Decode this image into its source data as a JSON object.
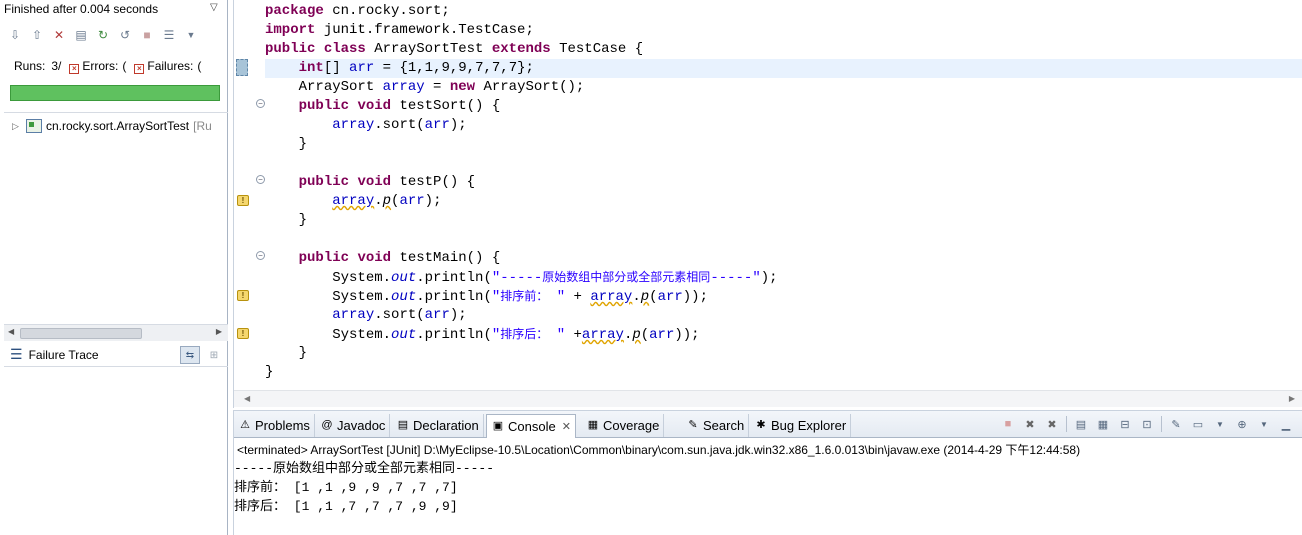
{
  "junit": {
    "status": "Finished after 0.004 seconds",
    "menu_glyph": "▽",
    "toolbar_icons": [
      "next-failure-icon",
      "prev-failure-icon",
      "show-failures-only-icon",
      "scroll-lock-icon",
      "rerun-icon",
      "rerun-failed-icon",
      "stop-icon",
      "history-icon",
      "dropdown-icon"
    ],
    "runs_label": "Runs:",
    "runs_value": "3/",
    "errors_label": "Errors:",
    "errors_value": "(",
    "failures_label": "Failures:",
    "failures_value": "(",
    "progress_fraction": 1.0,
    "tree_item_name": "cn.rocky.sort.ArraySortTest",
    "tree_item_suffix": "[Ru",
    "failure_trace_label": "Failure Trace"
  },
  "editor": {
    "lines": [
      {
        "indent": "",
        "parts": [
          [
            "kw",
            "package"
          ],
          [
            "p",
            " cn.rocky.sort;"
          ]
        ]
      },
      {
        "indent": "",
        "parts": [
          [
            "kw",
            "import"
          ],
          [
            "p",
            " junit.framework.TestCase;"
          ]
        ]
      },
      {
        "indent": "",
        "parts": [
          [
            "kw",
            "public"
          ],
          [
            "p",
            " "
          ],
          [
            "kw",
            "class"
          ],
          [
            "p",
            " ArraySortTest "
          ],
          [
            "kw",
            "extends"
          ],
          [
            "p",
            " TestCase {"
          ]
        ]
      },
      {
        "indent": "    ",
        "current": true,
        "parts": [
          [
            "kw",
            "int"
          ],
          [
            "p",
            "[] "
          ],
          [
            "fld",
            "arr"
          ],
          [
            "p",
            " = {1,1,9,9,7,7,7};"
          ]
        ]
      },
      {
        "indent": "    ",
        "parts": [
          [
            "p",
            "ArraySort "
          ],
          [
            "fld",
            "array"
          ],
          [
            "p",
            " = "
          ],
          [
            "kw",
            "new"
          ],
          [
            "p",
            " ArraySort();"
          ]
        ]
      },
      {
        "indent": "    ",
        "parts": [
          [
            "kw",
            "public"
          ],
          [
            "p",
            " "
          ],
          [
            "kw",
            "void"
          ],
          [
            "p",
            " testSort() {"
          ]
        ]
      },
      {
        "indent": "        ",
        "parts": [
          [
            "fld",
            "array"
          ],
          [
            "p",
            ".sort("
          ],
          [
            "fld",
            "arr"
          ],
          [
            "p",
            ");"
          ]
        ]
      },
      {
        "indent": "    ",
        "parts": [
          [
            "p",
            "}"
          ]
        ]
      },
      {
        "indent": "",
        "parts": []
      },
      {
        "indent": "    ",
        "parts": [
          [
            "kw",
            "public"
          ],
          [
            "p",
            " "
          ],
          [
            "kw",
            "void"
          ],
          [
            "p",
            " testP() {"
          ]
        ]
      },
      {
        "indent": "        ",
        "parts": [
          [
            "fld-w",
            "array"
          ],
          [
            "p",
            "."
          ],
          [
            "ital-w",
            "p"
          ],
          [
            "p",
            "("
          ],
          [
            "fld",
            "arr"
          ],
          [
            "p",
            ");"
          ]
        ]
      },
      {
        "indent": "    ",
        "parts": [
          [
            "p",
            "}"
          ]
        ]
      },
      {
        "indent": "",
        "parts": []
      },
      {
        "indent": "    ",
        "parts": [
          [
            "kw",
            "public"
          ],
          [
            "p",
            " "
          ],
          [
            "kw",
            "void"
          ],
          [
            "p",
            " testMain() {"
          ]
        ]
      },
      {
        "indent": "        ",
        "parts": [
          [
            "p",
            "System."
          ],
          [
            "fld-i",
            "out"
          ],
          [
            "p",
            ".println("
          ],
          [
            "str",
            "\"-----"
          ],
          [
            "str-cjk",
            "原始数组中部分或全部元素相同"
          ],
          [
            "str",
            "-----\""
          ],
          [
            "p",
            ");"
          ]
        ]
      },
      {
        "indent": "        ",
        "parts": [
          [
            "p",
            "System."
          ],
          [
            "fld-i",
            "out"
          ],
          [
            "p",
            ".println("
          ],
          [
            "str",
            "\""
          ],
          [
            "str-cjk",
            "排序前："
          ],
          [
            "str",
            " \""
          ],
          [
            "p",
            " + "
          ],
          [
            "fld-w",
            "array"
          ],
          [
            "p",
            "."
          ],
          [
            "ital-w",
            "p"
          ],
          [
            "p",
            "("
          ],
          [
            "fld",
            "arr"
          ],
          [
            "p",
            "));"
          ]
        ]
      },
      {
        "indent": "        ",
        "parts": [
          [
            "fld",
            "array"
          ],
          [
            "p",
            ".sort("
          ],
          [
            "fld",
            "arr"
          ],
          [
            "p",
            ");"
          ]
        ]
      },
      {
        "indent": "        ",
        "parts": [
          [
            "p",
            "System."
          ],
          [
            "fld-i",
            "out"
          ],
          [
            "p",
            ".println("
          ],
          [
            "str",
            "\""
          ],
          [
            "str-cjk",
            "排序后："
          ],
          [
            "str",
            " \""
          ],
          [
            "p",
            " +"
          ],
          [
            "fld-w",
            "array"
          ],
          [
            "p",
            "."
          ],
          [
            "ital-w",
            "p"
          ],
          [
            "p",
            "("
          ],
          [
            "fld",
            "arr"
          ],
          [
            "p",
            "));"
          ]
        ]
      },
      {
        "indent": "    ",
        "parts": [
          [
            "p",
            "}"
          ]
        ]
      },
      {
        "indent": "",
        "parts": [
          [
            "p",
            "}"
          ]
        ]
      }
    ]
  },
  "tabs": [
    {
      "label": "Problems",
      "icon": "problems-icon",
      "glyph": "⚠"
    },
    {
      "label": "Javadoc",
      "icon": "javadoc-icon",
      "glyph": "@"
    },
    {
      "label": "Declaration",
      "icon": "declaration-icon",
      "glyph": "▤"
    },
    {
      "label": "Console",
      "icon": "console-icon",
      "glyph": "▣",
      "active": true
    },
    {
      "label": "Coverage",
      "icon": "coverage-icon",
      "glyph": "▦"
    },
    {
      "label": "Search",
      "icon": "search-icon",
      "glyph": "✎"
    },
    {
      "label": "Bug Explorer",
      "icon": "bug-icon",
      "glyph": "✱"
    }
  ],
  "console": {
    "terminated_line": "<terminated> ArraySortTest [JUnit] D:\\MyEclipse-10.5\\Location\\Common\\binary\\com.sun.java.jdk.win32.x86_1.6.0.013\\bin\\javaw.exe (2014-4-29 下午12:44:58)",
    "output_lines": [
      "-----原始数组中部分或全部元素相同-----",
      "排序前： [1 ,1 ,9 ,9 ,7 ,7 ,7]",
      "排序后： [1 ,1 ,7 ,7 ,7 ,9 ,9]"
    ],
    "toolbar_icons": [
      "terminate-icon",
      "remove-launch-icon",
      "remove-all-icon",
      "scroll-lock-icon",
      "show-when-changes-icon",
      "pin-icon",
      "word-wrap-icon",
      "new-console-icon",
      "display-console-icon",
      "open-console-icon",
      "minimize-icon",
      "maximize-icon"
    ]
  },
  "colors": {
    "keyword": "#7f0055",
    "string": "#2a00ff",
    "field": "#0000c0",
    "progress_green": "#5fc15f",
    "current_line": "#e8f2fe"
  }
}
